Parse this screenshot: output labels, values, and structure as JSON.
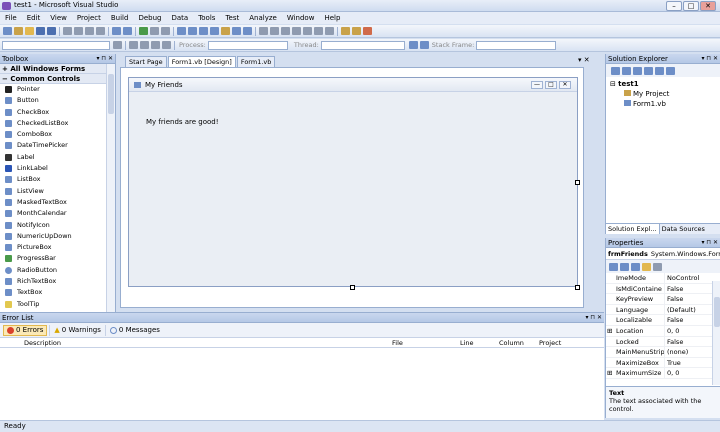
{
  "window": {
    "title": "test1 - Microsoft Visual Studio",
    "min": "–",
    "max": "□",
    "close": "✕"
  },
  "menu": [
    "File",
    "Edit",
    "View",
    "Project",
    "Build",
    "Debug",
    "Data",
    "Tools",
    "Test",
    "Analyze",
    "Window",
    "Help"
  ],
  "debugbar": {
    "process_label": "Process:",
    "thread_label": "Thread:",
    "stack_label": "Stack Frame:"
  },
  "toolbox": {
    "title": "Toolbox",
    "pin": "▾ ⊓ ✕",
    "groups": {
      "all": "All Windows Forms",
      "common": "Common Controls"
    },
    "group_signs": {
      "all": "+",
      "common": "−"
    },
    "items": [
      "Pointer",
      "Button",
      "CheckBox",
      "CheckedListBox",
      "ComboBox",
      "DateTimePicker",
      "Label",
      "LinkLabel",
      "ListBox",
      "ListView",
      "MaskedTextBox",
      "MonthCalendar",
      "NotifyIcon",
      "NumericUpDown",
      "PictureBox",
      "ProgressBar",
      "RadioButton",
      "RichTextBox",
      "TextBox",
      "ToolTip"
    ]
  },
  "tabs": [
    "Start Page",
    "Form1.vb [Design]",
    "Form1.vb"
  ],
  "doc_close": "▾ ✕",
  "form": {
    "title": "My Friends",
    "label": "My friends are good!",
    "min": "—",
    "max": "□",
    "close": "✕"
  },
  "solution": {
    "title": "Solution Explorer",
    "pin": "▾ ⊓ ✕",
    "root": "test1",
    "items": [
      "My Project",
      "Form1.vb"
    ],
    "tabs": [
      "Solution Expl...",
      "Data Sources"
    ]
  },
  "properties": {
    "title": "Properties",
    "pin": "▾ ⊓ ✕",
    "object": "frmFriends",
    "type": "System.Windows.Forr",
    "rows": [
      {
        "name": "ImeMode",
        "value": "NoControl",
        "sign": ""
      },
      {
        "name": "IsMdiContaine",
        "value": "False",
        "sign": ""
      },
      {
        "name": "KeyPreview",
        "value": "False",
        "sign": ""
      },
      {
        "name": "Language",
        "value": "(Default)",
        "sign": ""
      },
      {
        "name": "Localizable",
        "value": "False",
        "sign": ""
      },
      {
        "name": "Location",
        "value": "0, 0",
        "sign": "⊞"
      },
      {
        "name": "Locked",
        "value": "False",
        "sign": ""
      },
      {
        "name": "MainMenuStrip",
        "value": "(none)",
        "sign": ""
      },
      {
        "name": "MaximizeBox",
        "value": "True",
        "sign": ""
      },
      {
        "name": "MaximumSize",
        "value": "0, 0",
        "sign": "⊞"
      }
    ],
    "desc_title": "Text",
    "desc_text": "The text associated with the control."
  },
  "errors": {
    "title": "Error List",
    "pin": "▾ ⊓ ✕",
    "errors_btn": "0 Errors",
    "warnings_btn": "0 Warnings",
    "messages_btn": "0 Messages",
    "columns": [
      "Description",
      "File",
      "Line",
      "Column",
      "Project"
    ]
  },
  "status": "Ready"
}
